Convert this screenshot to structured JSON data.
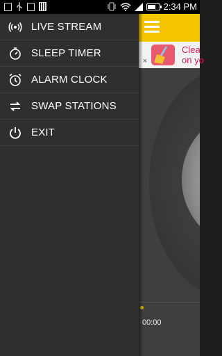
{
  "status_bar": {
    "time": "2:34",
    "time_period": "PM",
    "left_icons": [
      "screenshot-icon",
      "usb-icon",
      "code-icon",
      "barcode-icon"
    ],
    "right_icons": [
      "vibrate-icon",
      "wifi-icon",
      "signal-icon",
      "battery-icon"
    ],
    "battery_level": 0.7
  },
  "drawer": {
    "items": [
      {
        "label": "LIVE STREAM",
        "icon": "broadcast-icon"
      },
      {
        "label": "SLEEP TIMER",
        "icon": "timer-icon"
      },
      {
        "label": "ALARM CLOCK",
        "icon": "alarm-icon"
      },
      {
        "label": "SWAP STATIONS",
        "icon": "swap-icon"
      },
      {
        "label": "EXIT",
        "icon": "power-icon"
      }
    ]
  },
  "app": {
    "accent_color": "#f5c400",
    "ad": {
      "close_label": "×",
      "line1": "Clea",
      "line2": "on yo"
    },
    "player": {
      "elapsed": "00:00"
    }
  }
}
